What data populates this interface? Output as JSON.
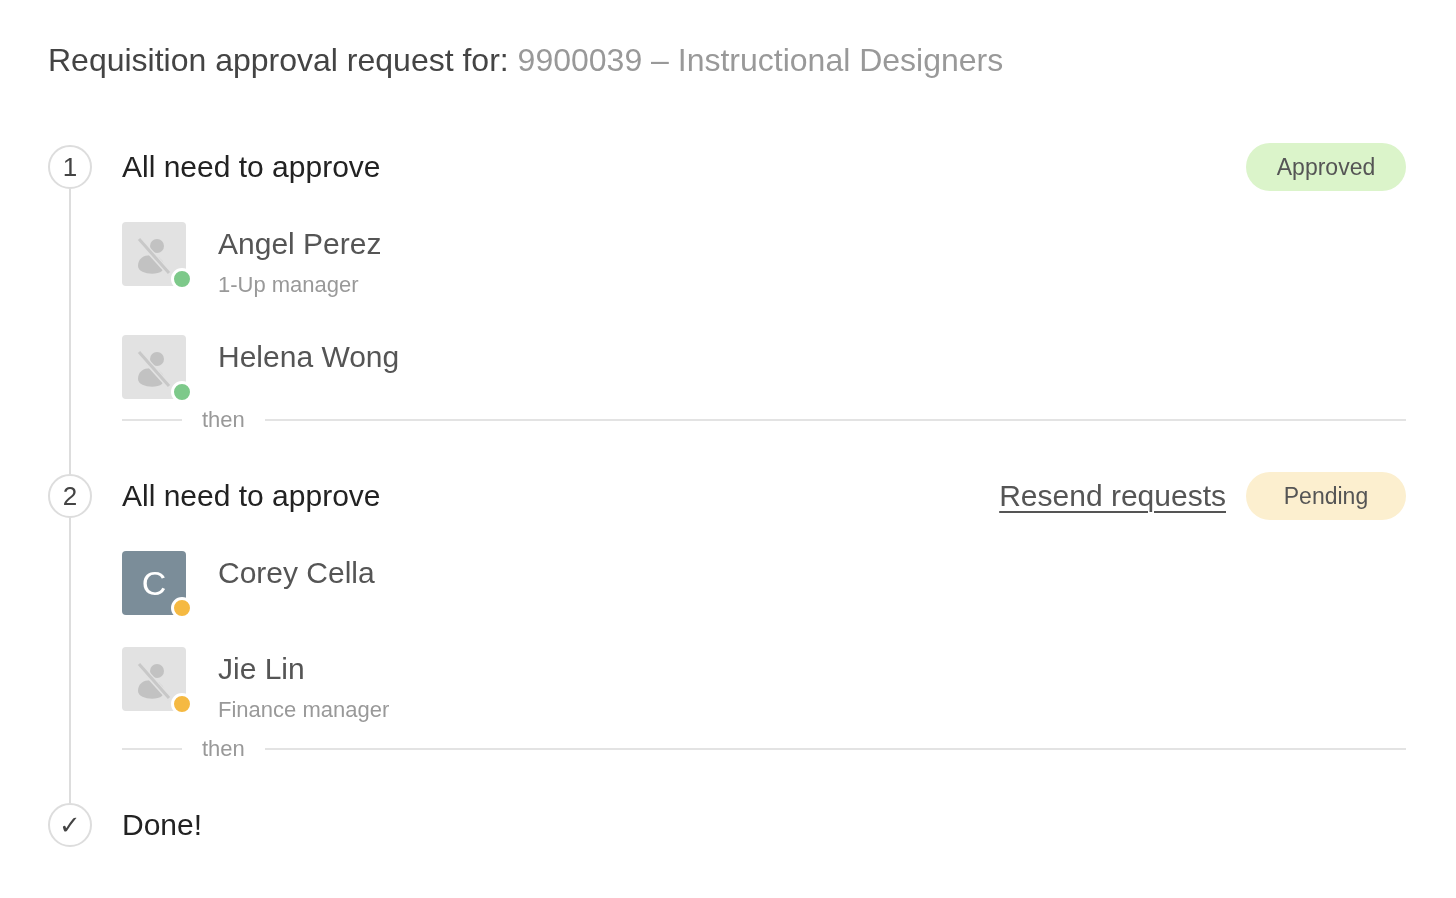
{
  "title": {
    "label": "Requisition approval request for:",
    "subject": "9900039 – Instructional Designers"
  },
  "steps": [
    {
      "marker": "1",
      "heading": "All need to approve",
      "status": {
        "kind": "approved",
        "label": "Approved"
      },
      "approvers": [
        {
          "name": "Angel Perez",
          "role": "1-Up manager",
          "avatar": {
            "kind": "no_photo"
          },
          "color": "#7dc98a"
        },
        {
          "name": "Helena Wong",
          "avatar": {
            "kind": "no_photo"
          },
          "color": "#7dc98a"
        }
      ],
      "separator": "then"
    },
    {
      "marker": "2",
      "heading": "All need to approve",
      "action": "Resend requests",
      "status": {
        "kind": "pending",
        "label": "Pending"
      },
      "approvers": [
        {
          "name": "Corey Cella",
          "avatar": {
            "kind": "initial",
            "initial": "C"
          },
          "color": "#f5b942"
        },
        {
          "name": "Jie Lin",
          "role": "Finance manager",
          "avatar": {
            "kind": "no_photo"
          },
          "color": "#f5b942"
        }
      ],
      "separator": "then"
    },
    {
      "marker": "✓",
      "heading": "Done!"
    }
  ]
}
